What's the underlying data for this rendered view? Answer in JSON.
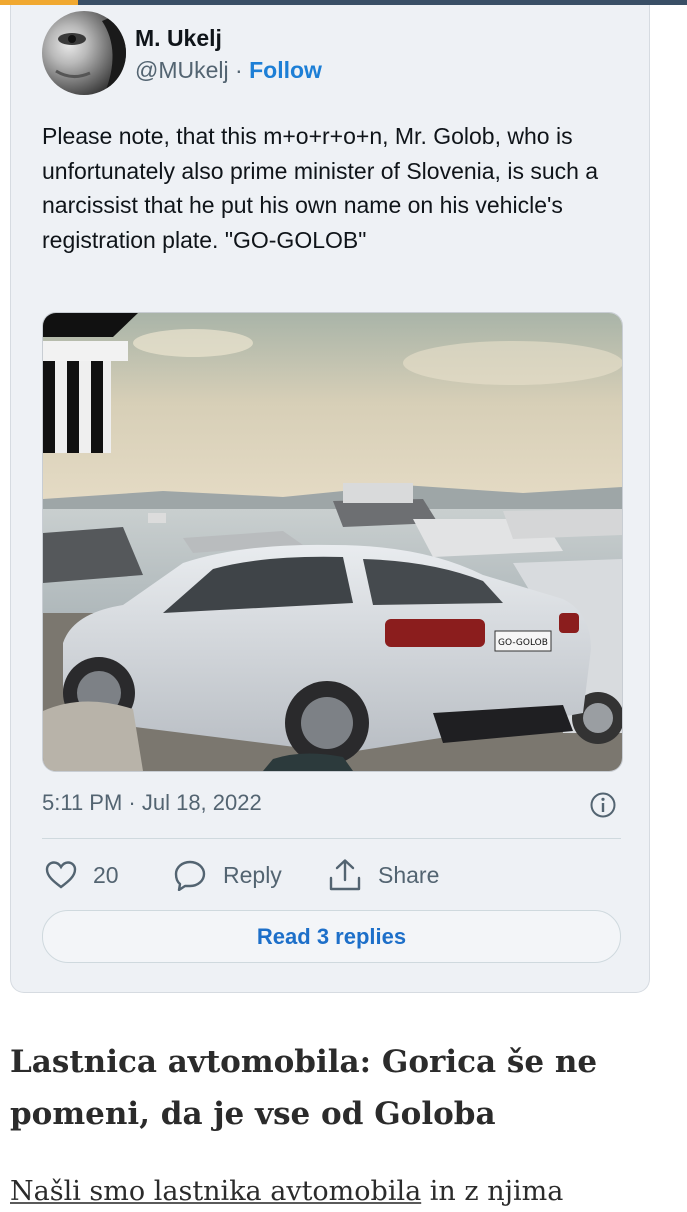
{
  "colors": {
    "accent": "#1d7fd6",
    "top_bar_orange": "#f0a830",
    "top_bar_dark": "#3a4f66"
  },
  "tweet": {
    "author_name": "M. Ukelj",
    "handle": "@MUkelj",
    "separator": "·",
    "follow_label": "Follow",
    "text": "Please note, that this m+o+r+o+n, Mr. Golob, who is unfortunately also prime minister of Slovenia, is such a narcissist that he put his own name on his vehicle's registration plate. \"GO-GOLOB\"",
    "photo": {
      "plate_text": "GO-GOLOB"
    },
    "timestamp": "5:11 PM · Jul 18, 2022",
    "info_icon": "info-icon",
    "like_icon": "heart-icon",
    "like_count": "20",
    "reply_icon": "speech-bubble-icon",
    "reply_label": "Reply",
    "share_icon": "share-upload-icon",
    "share_label": "Share",
    "read_replies_label": "Read 3 replies"
  },
  "article": {
    "headline": "Lastnica avtomobila: Gorica še ne pomeni, da je vse od Goloba",
    "body_link": "Našli smo lastnika avtomobila",
    "body_rest": " in z njima"
  }
}
